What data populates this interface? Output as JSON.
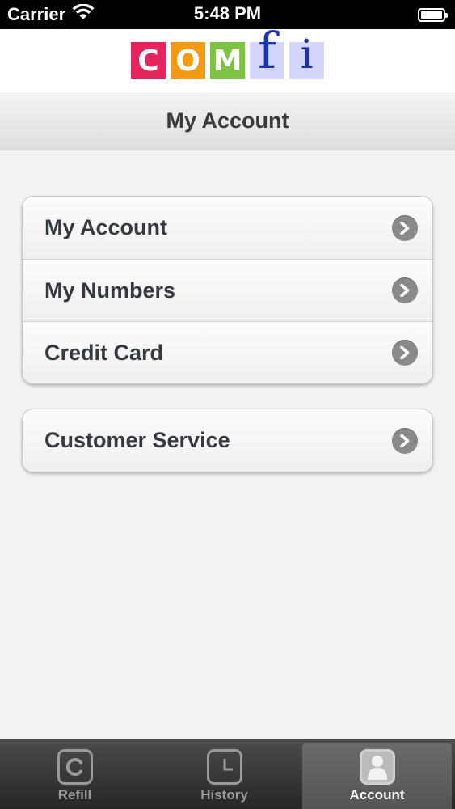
{
  "status_bar": {
    "carrier": "Carrier",
    "time": "5:48 PM"
  },
  "logo": {
    "letters": [
      "C",
      "O",
      "M",
      "f",
      "i"
    ]
  },
  "header": {
    "title": "My Account"
  },
  "menu": {
    "group_1": [
      {
        "label": "My Account"
      },
      {
        "label": "My Numbers"
      },
      {
        "label": "Credit Card"
      }
    ],
    "group_2": [
      {
        "label": "Customer Service"
      }
    ]
  },
  "tabs": [
    {
      "label": "Refill",
      "icon": "refill-icon",
      "active": false
    },
    {
      "label": "History",
      "icon": "clock-icon",
      "active": false
    },
    {
      "label": "Account",
      "icon": "person-icon",
      "active": true
    }
  ],
  "colors": {
    "logo_c": "#e6245e",
    "logo_o": "#f49a12",
    "logo_m": "#7dc242",
    "logo_fi_bg": "#d4d6ff",
    "logo_fi_text": "#1733b8"
  }
}
